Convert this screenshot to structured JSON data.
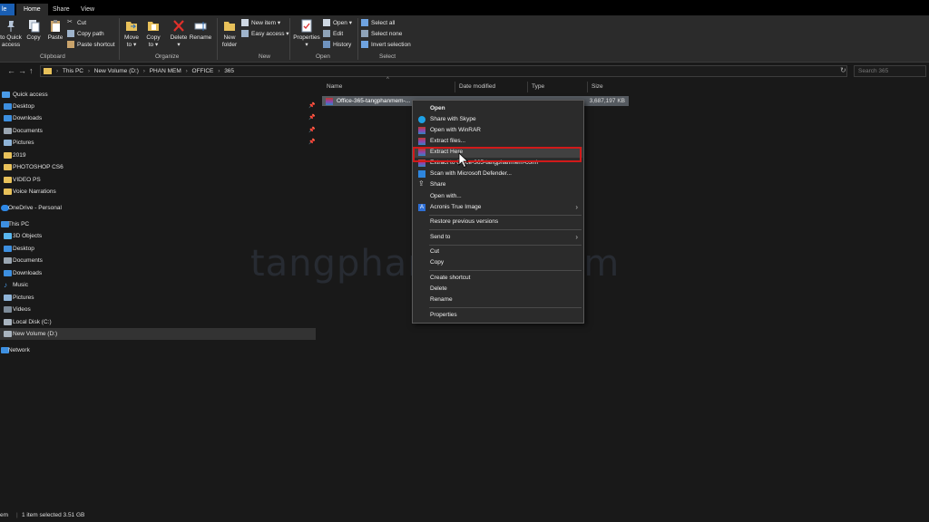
{
  "tabs": {
    "file": "le",
    "home": "Home",
    "share": "Share",
    "view": "View"
  },
  "ribbon": {
    "pin_quick_access": [
      "to Quick",
      "access"
    ],
    "copy": "Copy",
    "paste": "Paste",
    "cut": "Cut",
    "copy_path": "Copy path",
    "paste_shortcut": "Paste shortcut",
    "clipboard_label": "Clipboard",
    "move_to": [
      "Move",
      "to ▾"
    ],
    "copy_to": [
      "Copy",
      "to ▾"
    ],
    "delete": [
      "Delete",
      "▾"
    ],
    "rename": "Rename",
    "organize_label": "Organize",
    "new_folder": [
      "New",
      "folder"
    ],
    "new_item": "New item ▾",
    "easy_access": "Easy access ▾",
    "new_label": "New",
    "properties": [
      "Properties",
      "▾"
    ],
    "open": "Open ▾",
    "edit": "Edit",
    "history": "History",
    "open_label": "Open",
    "select_all": "Select all",
    "select_none": "Select none",
    "invert_selection": "Invert selection",
    "select_label": "Select"
  },
  "address": {
    "crumbs": [
      "This PC",
      "New Volume (D:)",
      "PHAN MEM",
      "OFFICE",
      "365"
    ],
    "search_placeholder": "Search 365"
  },
  "nav": {
    "quick_access": "Quick access",
    "quick_items": [
      "Desktop",
      "Downloads",
      "Documents",
      "Pictures",
      "2019",
      "PHOTOSHOP CS6",
      "VIDEO PS",
      "Voice Narrations"
    ],
    "onedrive": "OneDrive - Personal",
    "this_pc": "This PC",
    "pc_items": [
      "3D Objects",
      "Desktop",
      "Documents",
      "Downloads",
      "Music",
      "Pictures",
      "Videos",
      "Local Disk (C:)",
      "New Volume (D:)"
    ],
    "network": "Network"
  },
  "columns": {
    "name": "Name",
    "date": "Date modified",
    "type": "Type",
    "size": "Size"
  },
  "file": {
    "name": "Office-365-tangphanmem-...",
    "size": "3,687,197 KB"
  },
  "context_menu": {
    "open": "Open",
    "share_skype": "Share with Skype",
    "open_winrar": "Open with WinRAR",
    "extract_files": "Extract files...",
    "extract_here": "Extract Here",
    "extract_to": "Extract to Office-365-tangphanmem-com\\",
    "scan_defender": "Scan with Microsoft Defender...",
    "share": "Share",
    "open_with": "Open with...",
    "acronis": "Acronis True Image",
    "restore": "Restore previous versions",
    "send_to": "Send to",
    "cut": "Cut",
    "copy": "Copy",
    "create_shortcut": "Create shortcut",
    "delete": "Delete",
    "rename": "Rename",
    "properties": "Properties"
  },
  "watermark": "tangphanmem.com",
  "status": {
    "items": "em",
    "selected": "1 item selected  3.51 GB"
  },
  "colors": {
    "accent": "#1a5fb4",
    "highlight": "#d11a1a",
    "folder": "#e8c15a"
  }
}
